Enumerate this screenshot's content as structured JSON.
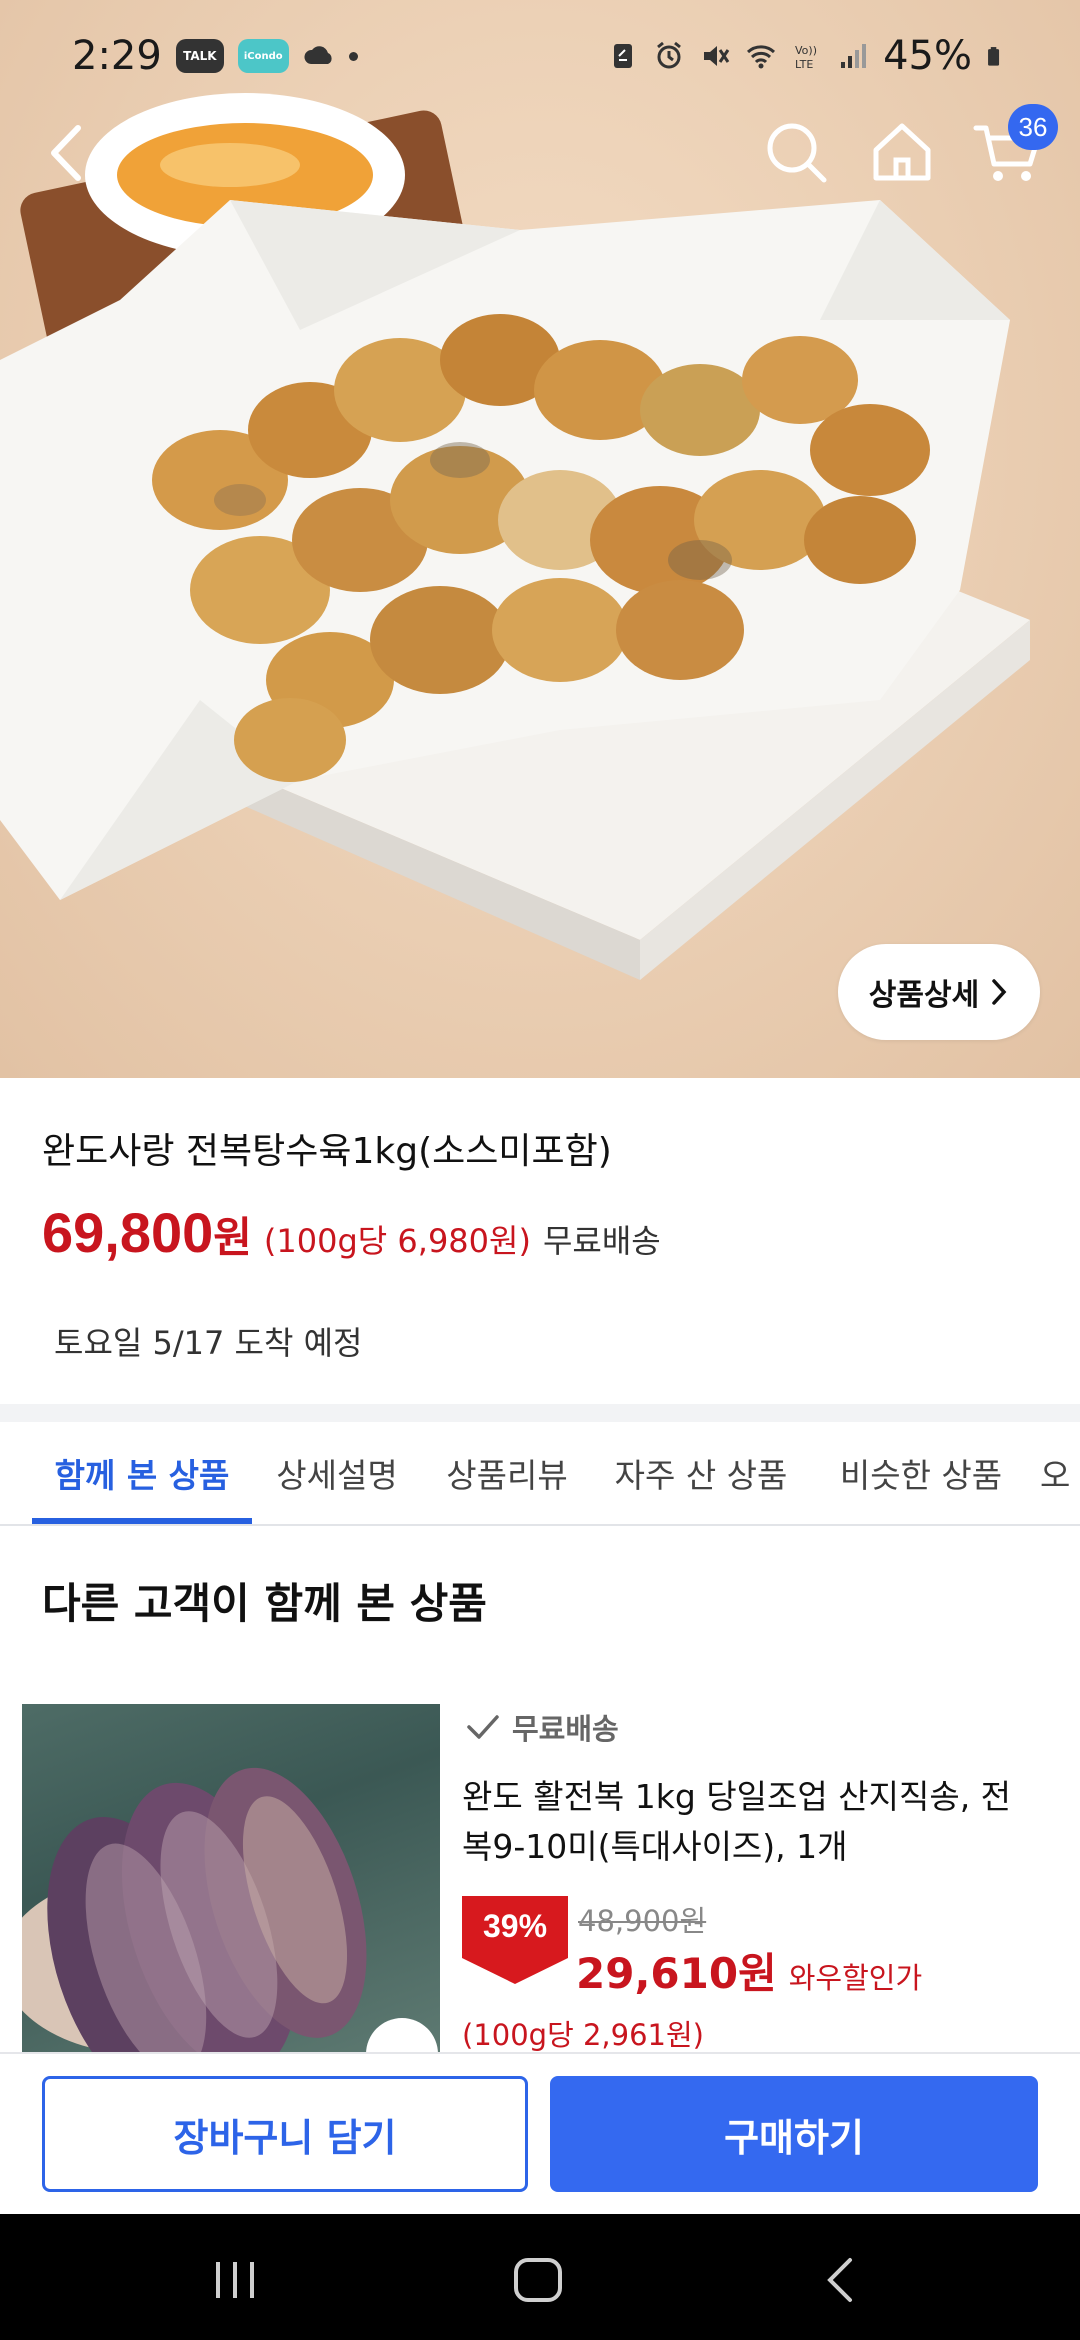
{
  "status_bar": {
    "time": "2:29",
    "badge_talk": "TALK",
    "badge_app": "iCondo",
    "battery": "45%"
  },
  "header": {
    "cart_count": "36"
  },
  "hero": {
    "detail_button": "상품상세"
  },
  "product": {
    "title": "완도사랑 전복탕수육1kg(소스미포함)",
    "price": "69,800",
    "price_currency": "원",
    "unit_price": "(100g당 6,980원)",
    "shipping": "무료배송",
    "arrival": "토요일 5/17 도착 예정"
  },
  "tabs": [
    {
      "label": "함께 본 상품"
    },
    {
      "label": "상세설명"
    },
    {
      "label": "상품리뷰"
    },
    {
      "label": "자주 산 상품"
    },
    {
      "label": "비슷한 상품"
    },
    {
      "label": "오"
    }
  ],
  "section": {
    "title": "다른 고객이 함께 본 상품"
  },
  "recommendation": {
    "shipping": "무료배송",
    "title": "완도 활전복 1kg 당일조업 산지직송, 전복9-10미(특대사이즈), 1개",
    "discount": "39%",
    "original_price": "48,900원",
    "price": "29,610원",
    "price_label": "와우할인가",
    "unit_price": "(100g당 2,961원)"
  },
  "actions": {
    "add_to_cart": "장바구니 담기",
    "buy_now": "구매하기"
  },
  "colors": {
    "accent_blue": "#3469f0",
    "price_red": "#c8151e"
  }
}
